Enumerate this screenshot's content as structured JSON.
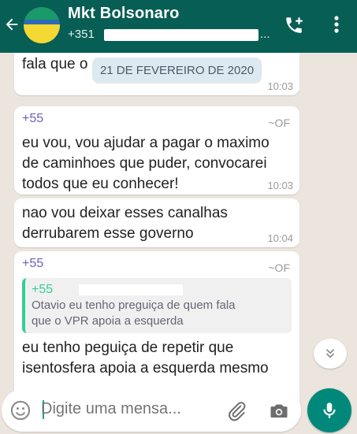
{
  "header": {
    "title": "Mkt Bolsonaro",
    "subtitle_prefix": "+351",
    "subtitle_suffix": "..."
  },
  "chat": {
    "date_chip": "21 DE FEVEREIRO DE 2020",
    "messages": [
      {
        "text": "fala que o",
        "time": "10:03"
      },
      {
        "sender": "+55",
        "push_name": "~OF",
        "text_lines": [
          "eu vou, vou ajudar a pagar o maximo",
          "de caminhoes que puder, convocarei",
          "todos que eu conhecer!"
        ],
        "time": "10:03"
      },
      {
        "text_lines": [
          "nao vou deixar esses canalhas",
          "derrubarem esse governo"
        ],
        "time": "10:04"
      },
      {
        "sender": "+55",
        "push_name": "~OF",
        "quote": {
          "sender": "+55",
          "text_lines": [
            "Otavio eu tenho preguiça de quem fala",
            "que o VPR apoia a esquerda"
          ]
        },
        "text_lines": [
          "eu tenho peguiça de repetir que",
          "isentosfera apoia a esquerda mesmo"
        ]
      }
    ]
  },
  "input": {
    "placeholder": "Digite uma mensa..."
  },
  "colors": {
    "header": "#075E54",
    "accent": "#00897B",
    "sender": "#6a62c0",
    "quote_bar": "#35cd96"
  },
  "icons": [
    "back-arrow-icon",
    "add-call-icon",
    "more-vert-icon",
    "scroll-down-icon",
    "emoji-icon",
    "attach-icon",
    "camera-icon",
    "mic-icon"
  ]
}
